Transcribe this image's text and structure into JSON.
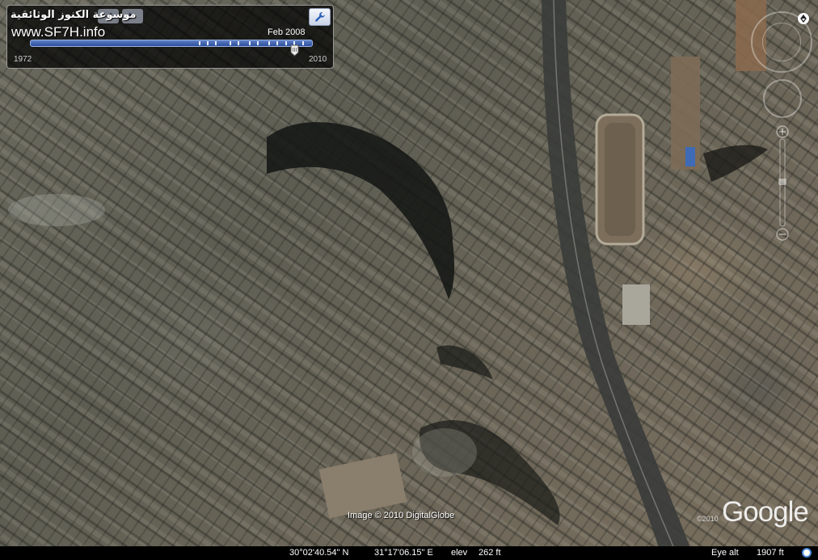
{
  "watermark": {
    "arabic_text": "موسوعة الكنوز الوثائقية",
    "url": "www.SF7H.info"
  },
  "time_slider": {
    "current_date": "Feb 2008",
    "start_year": "1972",
    "end_year": "2010",
    "position_fraction": 0.94,
    "settings_icon": "wrench-icon"
  },
  "map": {
    "imagery_credit": "Image © 2010 DigitalGlobe",
    "logo_small": "©2010",
    "logo": "Google"
  },
  "status_bar": {
    "latitude": "30°02'40.54\" N",
    "longitude": "31°17'06.15\" E",
    "elev_label": "elev",
    "elev_value": "262 ft",
    "eye_alt_label": "Eye alt",
    "eye_alt_value": "1907 ft"
  },
  "navigation": {
    "north_icon": "north-arrow-icon",
    "look_icon": "look-ring-icon",
    "move_icon": "move-ring-icon",
    "zoom_icon": "zoom-slider-icon"
  }
}
